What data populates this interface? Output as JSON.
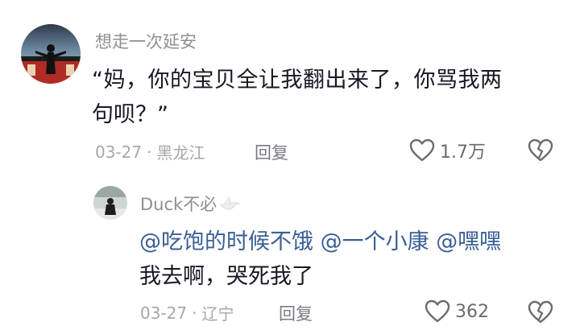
{
  "comment": {
    "username": "想走一次延安",
    "text_line1": "“妈，你的宝贝全让我翻出来了，你骂我两",
    "text_line2": "句呗？”",
    "date": "03-27",
    "separator": "·",
    "location": "黑龙江",
    "reply_label": "回复",
    "like_count": "1.7万"
  },
  "reply": {
    "username": "Duck不必",
    "mentions": [
      "@吃饱的时候不饿",
      "@一个小康",
      "@嘿嘿"
    ],
    "text": "我去啊，哭死我了",
    "date": "03-27",
    "separator": "·",
    "location": "辽宁",
    "reply_label": "回复",
    "like_count": "362"
  },
  "icons": [
    "avatar",
    "heart-outline-icon",
    "broken-heart-icon",
    "dove-icon"
  ],
  "colors": {
    "mention": "#3a5f95",
    "meta": "#a7a7ab",
    "text": "#161823"
  }
}
